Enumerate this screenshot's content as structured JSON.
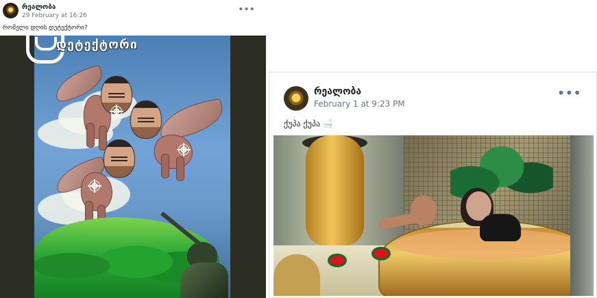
{
  "left_post": {
    "author": "რეალობა",
    "timestamp": "29 February at 16:26",
    "caption": "რომელი დღის დეტექტორი?",
    "image_title": "დეტექტორი",
    "more_icon": "more-horizontal-icon"
  },
  "right_post": {
    "author": "რეალობა",
    "timestamp": "February 1 at 9:23 PM",
    "caption": "ქუპა ქუპა 🛁",
    "more_icon": "more-horizontal-icon"
  },
  "colors": {
    "text": "#1c1e21",
    "muted": "#6b7280",
    "border": "#dde1e7",
    "dark_frame": "#2c2d23"
  }
}
